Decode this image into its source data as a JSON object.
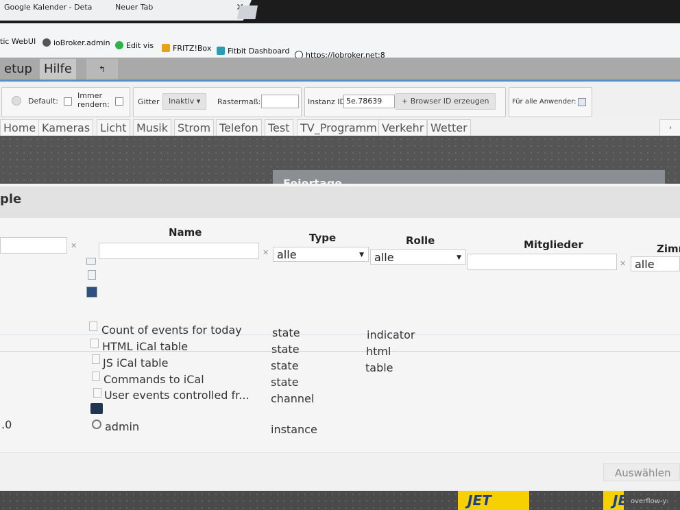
{
  "browser": {
    "tabs": [
      {
        "title": "Google Kalender - Deta"
      },
      {
        "title": "Neuer Tab"
      }
    ],
    "bookmarks": [
      {
        "label": "tic WebUI"
      },
      {
        "label": "ioBroker.admin"
      },
      {
        "label": "Edit vis"
      },
      {
        "label": "FRITZ!Box"
      },
      {
        "label": "Fitbit Dashboard"
      },
      {
        "label": "https://iobroker.net:8"
      }
    ]
  },
  "menu": {
    "setup": "etup",
    "hilfe": "Hilfe",
    "undo_icon": "undo-icon"
  },
  "toolbar": {
    "default_label": "Default:",
    "immer_rendern_line1": "Immer",
    "immer_rendern_line2": "rendern:",
    "gitter_label": "Gitter",
    "gitter_value": "Inaktiv",
    "rastermass_label": "Rastermaß:",
    "rastermass_value": "",
    "instanz_label": "Instanz ID",
    "instanz_value": "5e.78639",
    "browser_id_button": "Browser ID erzeugen",
    "fuer_alle_label": "Für alle Anwender:"
  },
  "views": [
    "Home",
    "Kameras",
    "Licht",
    "Musik",
    "Strom",
    "Telefon",
    "Test",
    "TV_Programm",
    "Verkehr",
    "Wetter"
  ],
  "widget_title": "Feiertage",
  "dialog": {
    "title": "ple",
    "columns": {
      "name": "Name",
      "type": "Type",
      "rolle": "Rolle",
      "mitglieder": "Mitglieder",
      "zimmer": "Zimm"
    },
    "filters": {
      "type": "alle",
      "rolle": "alle",
      "zimmer": "alle"
    },
    "rows": [
      {
        "name": "Count of events for today",
        "type": "state",
        "role": "indicator"
      },
      {
        "name": "HTML iCal table",
        "type": "state",
        "role": "html"
      },
      {
        "name": "JS iCal table",
        "type": "state",
        "role": "table"
      },
      {
        "name": "Commands to iCal",
        "type": "state",
        "role": ""
      },
      {
        "name": "User events controlled fr...",
        "type": "channel",
        "role": ""
      }
    ],
    "instance_row": {
      "left": ".0",
      "name": "admin",
      "type": "instance"
    },
    "select_button": "Auswählen"
  },
  "bottom": {
    "jet": "JET",
    "jet2": "JE",
    "overflow": "overflow-y:"
  },
  "colors": {
    "accent": "#5b8dd0",
    "menu": "#a9a9a9",
    "widget_header": "#8b8f94",
    "jet_yellow": "#f6d000"
  }
}
